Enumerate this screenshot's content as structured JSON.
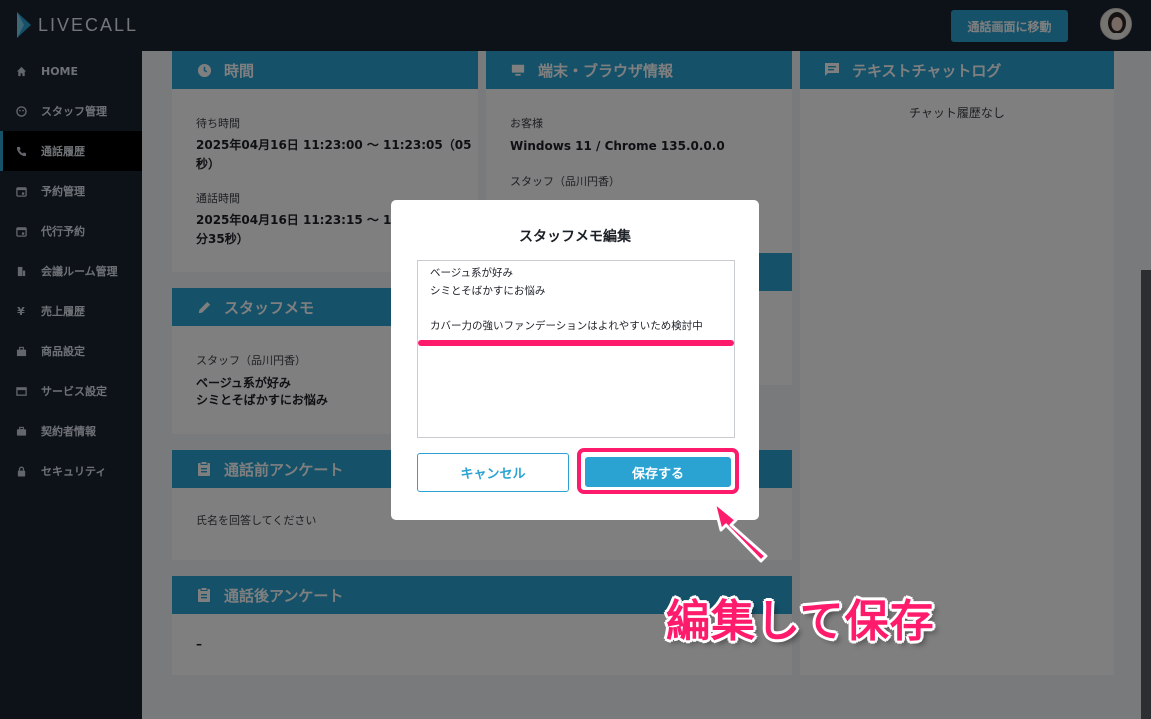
{
  "app": {
    "logo_text": "LIVECALL"
  },
  "topbar": {
    "call_screen_button": "通話画面に移動"
  },
  "sidebar": {
    "items": [
      {
        "label": "HOME",
        "icon": "home-icon"
      },
      {
        "label": "スタッフ管理",
        "icon": "staff-icon"
      },
      {
        "label": "通話履歴",
        "icon": "call-history-icon",
        "active": true
      },
      {
        "label": "予約管理",
        "icon": "calendar-icon"
      },
      {
        "label": "代行予約",
        "icon": "calendar-icon"
      },
      {
        "label": "会議ルーム管理",
        "icon": "room-icon"
      },
      {
        "label": "売上履歴",
        "icon": "yen-icon"
      },
      {
        "label": "商品設定",
        "icon": "product-icon"
      },
      {
        "label": "サービス設定",
        "icon": "service-icon"
      },
      {
        "label": "契約者情報",
        "icon": "briefcase-icon"
      },
      {
        "label": "セキュリティ",
        "icon": "lock-icon"
      }
    ]
  },
  "cards": {
    "time": {
      "title": "時間",
      "wait_label": "待ち時間",
      "wait_value_1": "2025年04月16日 11:23:00 〜 11:23:05（05",
      "wait_value_2": "秒）",
      "call_label": "通話時間",
      "call_value_1": "2025年04月16日 11:23:15 〜 11:2",
      "call_value_2": "分35秒）"
    },
    "device": {
      "title": "端末・ブラウザ情報",
      "customer_label": "お客様",
      "customer_value": "Windows 11 / Chrome 135.0.0.0",
      "staff_label": "スタッフ（品川円香）"
    },
    "chat": {
      "title": "テキストチャットログ",
      "empty": "チャット履歴なし"
    },
    "memo": {
      "title": "スタッフメモ",
      "staff_label": "スタッフ（品川円香）",
      "line1": "ベージュ系が好み",
      "line2": "シミとそばかすにお悩み"
    },
    "pre_survey": {
      "title": "通話前アンケート",
      "prompt": "氏名を回答してください"
    },
    "post_survey": {
      "title": "通話後アンケート",
      "value": "–"
    }
  },
  "modal": {
    "title": "スタッフメモ編集",
    "memo_lines": [
      "ベージュ系が好み",
      "シミとそばかすにお悩み",
      "",
      "カバー力の強いファンデーションはよれやすいため検討中"
    ],
    "cancel_label": "キャンセル",
    "save_label": "保存する"
  },
  "annotation": {
    "text": "編集して保存"
  },
  "colors": {
    "accent": "#2aa3d3",
    "highlight": "#ff1b6b",
    "dark": "#1b2230"
  }
}
